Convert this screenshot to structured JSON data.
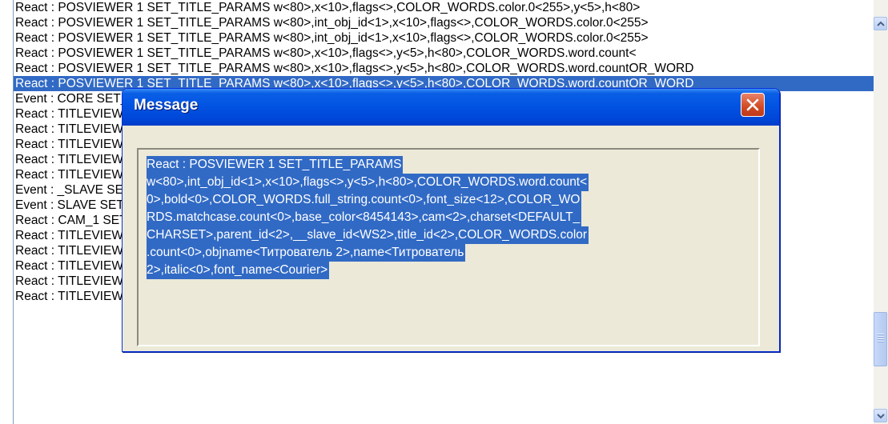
{
  "log": {
    "rows": [
      "React : POSVIEWER 1 SET_TITLE_PARAMS w<80>,x<10>,flags<>,COLOR_WORDS.color.0<255>,y<5>,h<80>",
      "React : POSVIEWER 1 SET_TITLE_PARAMS w<80>,int_obj_id<1>,x<10>,flags<>,COLOR_WORDS.color.0<255>",
      "React : POSVIEWER 1 SET_TITLE_PARAMS w<80>,int_obj_id<1>,x<10>,flags<>,COLOR_WORDS.color.0<255>",
      "React : POSVIEWER 1 SET_TITLE_PARAMS w<80>,x<10>,flags<>,y<5>,h<80>,COLOR_WORDS.word.count<",
      "React : POSVIEWER 1 SET_TITLE_PARAMS w<80>,x<10>,flags<>,y<5>,h<80>,COLOR_WORDS.word.countOR_WORD",
      "React : POSVIEWER 1 SET_TITLE_PARAMS w<80>,x<10>,flags<>,y<5>,h<80>,COLOR_WORDS.word.countOR_WORD",
      "Event : CORE SET_TITLE_PARAMS w<80>,x<10>,flags<>,y<5>,h<80>,COLOR_WORDS.word.count<0>,TITLE_PA",
      "React : TITLEVIEWER 1 SET_TITLE_PARAMS w<80>,x<10>,flags<>,COLOR_WORDS.word.count<0>,y<5>,h<80>",
      "React : TITLEVIEWER 1 SET_TITLE_PARAMS w<80>,x<10>,flags<>,COLOR_WORDS.word.count<0>,1>,COLOR_",
      "React : TITLEVIEWER 1 SET_TITLE_PARAMS w<80>,x<10>,flags<>,COLOR_WORDS.word.count<0>,<>,decoder-",
      "React : TITLEVIEWER 1 SET_TITLE_PARAMS w<80>,x<10>,flags<>,COLOR_WORDS.word.count<0>rint<1>,hide",
      "React : TITLEVIEWER 1 SET_TITLE_PARAMS w<80>,x<10>,flags<>,COLOR_WORDS.word.count<0>",
      "Event : _SLAVE SET_TITLE_PARAMS w<80>,x<10>,flags<>,COLOR_WORDS.word.count<0>global<1>,_",
      "Event : SLAVE SET_TITLE_PARAMS w<80>,x<10>,flags<>,COLOR_WORDS.word.count<0>11>,slave_",
      "React : CAM_1 SET_TITLE_PARAMS w<80>,x<10>,flags<>,COLOR_WORDS.word.count<0>,back_path",
      "React : TITLEVIEWER 1 SET_TITLE_PARAMS w<80>,x<10>,flags<>,COLOR_WORDS.word5>,y<5>,h<8",
      "React : TITLEVIEWER 1 SET_TITLE_PARAMS w<80>,x<10>,flags<>,COLOR_WORDS.wordS.color.0<2",
      "React : TITLEVIEWER 1 SET_TITLE_PARAMS w<80>,int_obj_id<1>,x<10>,flags<>,COLOR_WORDS.color.0<2",
      "React : TITLEVIEWER 1 SET_TITLE_PARAMS w<80>,x<10>,flags<>,y<5>,h<80>,COLOR_WORDS.word.cour",
      "React : TITLEVIEWER 1 SET_TITLE_PARAMS w<80>,int_obj_id<1>,x<10>,flags<>,y<5>,h<80>,COLOR_WOR"
    ],
    "selected_index": 5
  },
  "dialog": {
    "title": "Message",
    "message_lines": [
      "React : POSVIEWER 1 SET_TITLE_PARAMS",
      "w<80>,int_obj_id<1>,x<10>,flags<>,y<5>,h<80>,COLOR_WORDS.word.count<",
      "0>,bold<0>,COLOR_WORDS.full_string.count<0>,font_size<12>,COLOR_WO",
      "RDS.matchcase.count<0>,base_color<8454143>,cam<2>,charset<DEFAULT_",
      "CHARSET>,parent_id<2>,__slave_id<WS2>,title_id<2>,COLOR_WORDS.color",
      ".count<0>,objname<Титрователь 2>,name<Титрователь",
      "2>,italic<0>,font_name<Courier>"
    ]
  },
  "colors": {
    "selection": "#316ac5",
    "titlebar": "#0054e3",
    "dialog_face": "#ece9d8",
    "close_button": "#d14a22"
  }
}
